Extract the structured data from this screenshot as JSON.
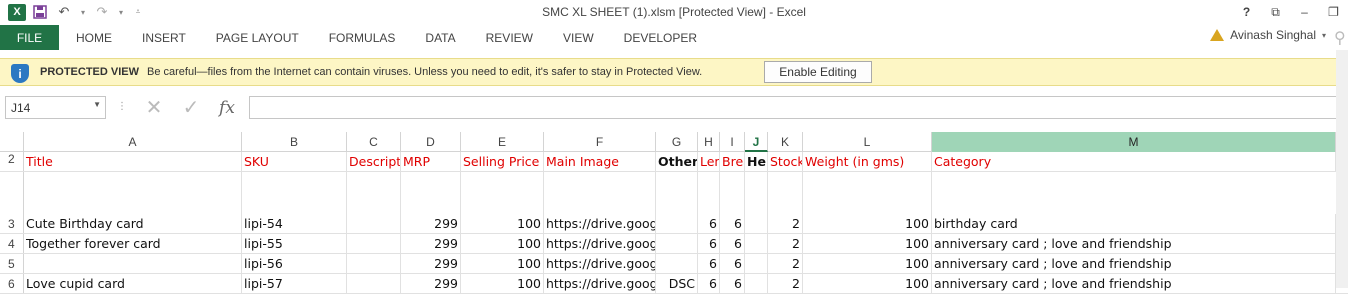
{
  "app": {
    "logo": "X",
    "window_title": "SMC XL SHEET (1).xlsm  [Protected View] - Excel",
    "window_controls": [
      "?",
      "⧉",
      "–",
      "⧉"
    ]
  },
  "ribbon": {
    "tabs": [
      "FILE",
      "HOME",
      "INSERT",
      "PAGE LAYOUT",
      "FORMULAS",
      "DATA",
      "REVIEW",
      "VIEW",
      "DEVELOPER"
    ],
    "user_name": "Avinash Singhal"
  },
  "protected_view": {
    "title": "PROTECTED VIEW",
    "message": "Be careful—files from the Internet can contain viruses. Unless you need to edit, it's safer to stay in Protected View.",
    "button_label": "Enable Editing"
  },
  "formula_bar": {
    "name_box": "J14",
    "formula": ""
  },
  "sheet": {
    "columns": [
      "A",
      "B",
      "C",
      "D",
      "E",
      "F",
      "G",
      "H",
      "I",
      "J",
      "K",
      "L",
      "M"
    ],
    "selected_column": "M",
    "current_column": "J",
    "header_row": {
      "number": "2",
      "cells": [
        "Title",
        "SKU",
        "Descript",
        "MRP",
        "Selling Price",
        "Main Image",
        "Other",
        "Len",
        "Brea",
        "Hei",
        "Stock",
        "Weight (in gms)",
        "Category"
      ]
    },
    "rows": [
      {
        "number": "3",
        "cells": [
          "Cute Birthday card",
          "lipi-54",
          "",
          "299",
          "100",
          "https://drive.google.com/fil",
          "",
          "6",
          "6",
          "",
          "2",
          "100",
          "birthday card"
        ]
      },
      {
        "number": "4",
        "cells": [
          "Together forever card",
          "lipi-55",
          "",
          "299",
          "100",
          "https://drive.google.com/fil",
          "",
          "6",
          "6",
          "",
          "2",
          "100",
          "anniversary card  ;  love and friendship"
        ]
      },
      {
        "number": "5",
        "cells": [
          "",
          "lipi-56",
          "",
          "299",
          "100",
          "https://drive.google.com/fil",
          "",
          "6",
          "6",
          "",
          "2",
          "100",
          "anniversary card  ;  love and friendship"
        ]
      },
      {
        "number": "6",
        "cells": [
          "Love cupid card",
          "lipi-57",
          "",
          "299",
          "100",
          "https://drive.google",
          "DSC",
          "6",
          "6",
          "",
          "2",
          "100",
          "anniversary card  ;  love and friendship"
        ]
      }
    ]
  },
  "colors": {
    "excel_green": "#217346",
    "header_red": "#e00000",
    "protected_bar": "#fdf6c5",
    "selected_col": "#9fd5b7"
  }
}
